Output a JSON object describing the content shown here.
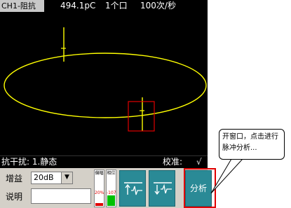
{
  "header": {
    "channel": "CH1-阻抗",
    "charge": "494.1pC",
    "count": "1个口",
    "rate": "100次/秒"
  },
  "footer": {
    "interference": "抗干扰: 1.静态",
    "calibration": "校准:",
    "calibration_mark": "√"
  },
  "controls": {
    "gain_label": "增益",
    "gain_value": "20dB",
    "description_label": "说明",
    "description_value": "",
    "meter_amplitude_label": "偏幅",
    "meter_amplitude_value": "20%",
    "meter_amplitude_level": 0.2,
    "meter_phase_label": "相位",
    "meter_phase_value": "-107",
    "meter_phase_level": 0.7,
    "analyze_label": "分析"
  },
  "annotation": {
    "text": "开窗口，点击进行脉冲分析..."
  },
  "colors": {
    "trace": "#ffff00",
    "screen_bg": "#000000",
    "button_bg": "#2a8a96",
    "highlight": "#e00000",
    "meter_amplitude": "#e00000",
    "meter_phase": "#00c000"
  },
  "icons": {
    "pulse_button_1": "pulse-up-icon",
    "pulse_button_2": "pulse-down-icon",
    "dropdown": "chevron-down-icon"
  }
}
